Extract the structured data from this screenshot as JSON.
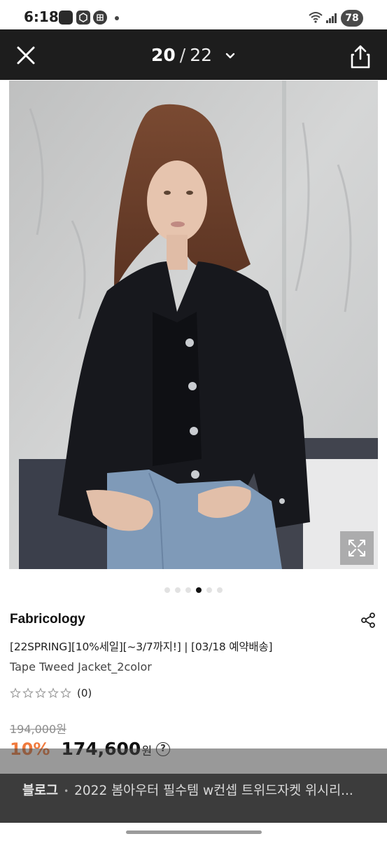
{
  "status_bar": {
    "time": "6:18",
    "battery": "78",
    "icons": [
      "weather-news-icon",
      "package-icon",
      "grid-app-icon",
      "notification-dot",
      "wifi-icon",
      "signal-icon",
      "battery-icon"
    ]
  },
  "header": {
    "current_page": "20",
    "separator": "/",
    "total_pages": "22",
    "icons": [
      "close-icon",
      "chevron-down-icon",
      "share-upload-icon"
    ]
  },
  "gallery": {
    "image_alt": "Model wearing black tweed jacket",
    "dots_count": 6,
    "active_dot": 3,
    "expand_icon": "expand-arrows-icon"
  },
  "product": {
    "brand": "Fabricology",
    "promo_line": "[22SPRING][10%세일][~3/7까지!] | [03/18 예약배송]",
    "name": "Tape Tweed Jacket_2color",
    "review_count": "(0)",
    "star_rating": 0,
    "original_price": "194,000원",
    "discount": "10%",
    "price": "174,600",
    "currency": "원",
    "help_label": "?"
  },
  "banner": {
    "source": "블로그",
    "separator": "•",
    "title": "2022 봄아우터 필수템 w컨셉 트위드자켓 위시리..."
  },
  "colors": {
    "header_bg": "#1d1d1d",
    "discount": "#f07a3d",
    "banner_bg": "#3c3c3c"
  }
}
